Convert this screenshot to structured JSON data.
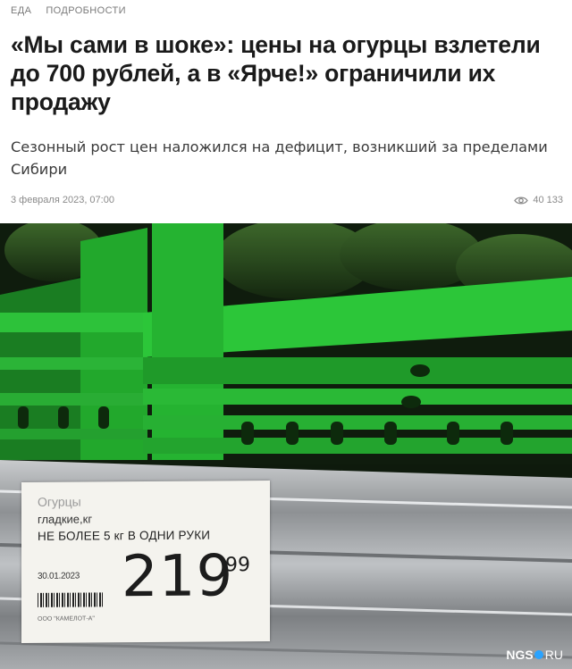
{
  "breadcrumbs": [
    "ЕДА",
    "ПОДРОБНОСТИ"
  ],
  "article": {
    "title": "«Мы сами в шоке»: цены на огурцы взлетели до 700 рублей, а в «Ярче!» ограничили их продажу",
    "subtitle": "Сезонный рост цен наложился на дефицит, возникший за пределами Сибири",
    "date": "3 февраля 2023, 07:00",
    "views": "40 133"
  },
  "icons": {
    "views": "eye-icon"
  },
  "price_tag": {
    "product": "Огурцы",
    "variety": "гладкие,кг",
    "limit": "НЕ БОЛЕЕ 5 кг В ОДНИ РУКИ",
    "date": "30.01.2023",
    "rubles": "219",
    "kopecks": "99",
    "code": "ООО \"КАМЕЛОТ-А\""
  },
  "watermark": {
    "brand": "NGS",
    "suffix": "RU",
    "dot_color": "#2aa3ff"
  },
  "colors": {
    "crate_green": "#1fa52a",
    "text": "#1a1a1a",
    "meta": "#8a8a8a"
  }
}
